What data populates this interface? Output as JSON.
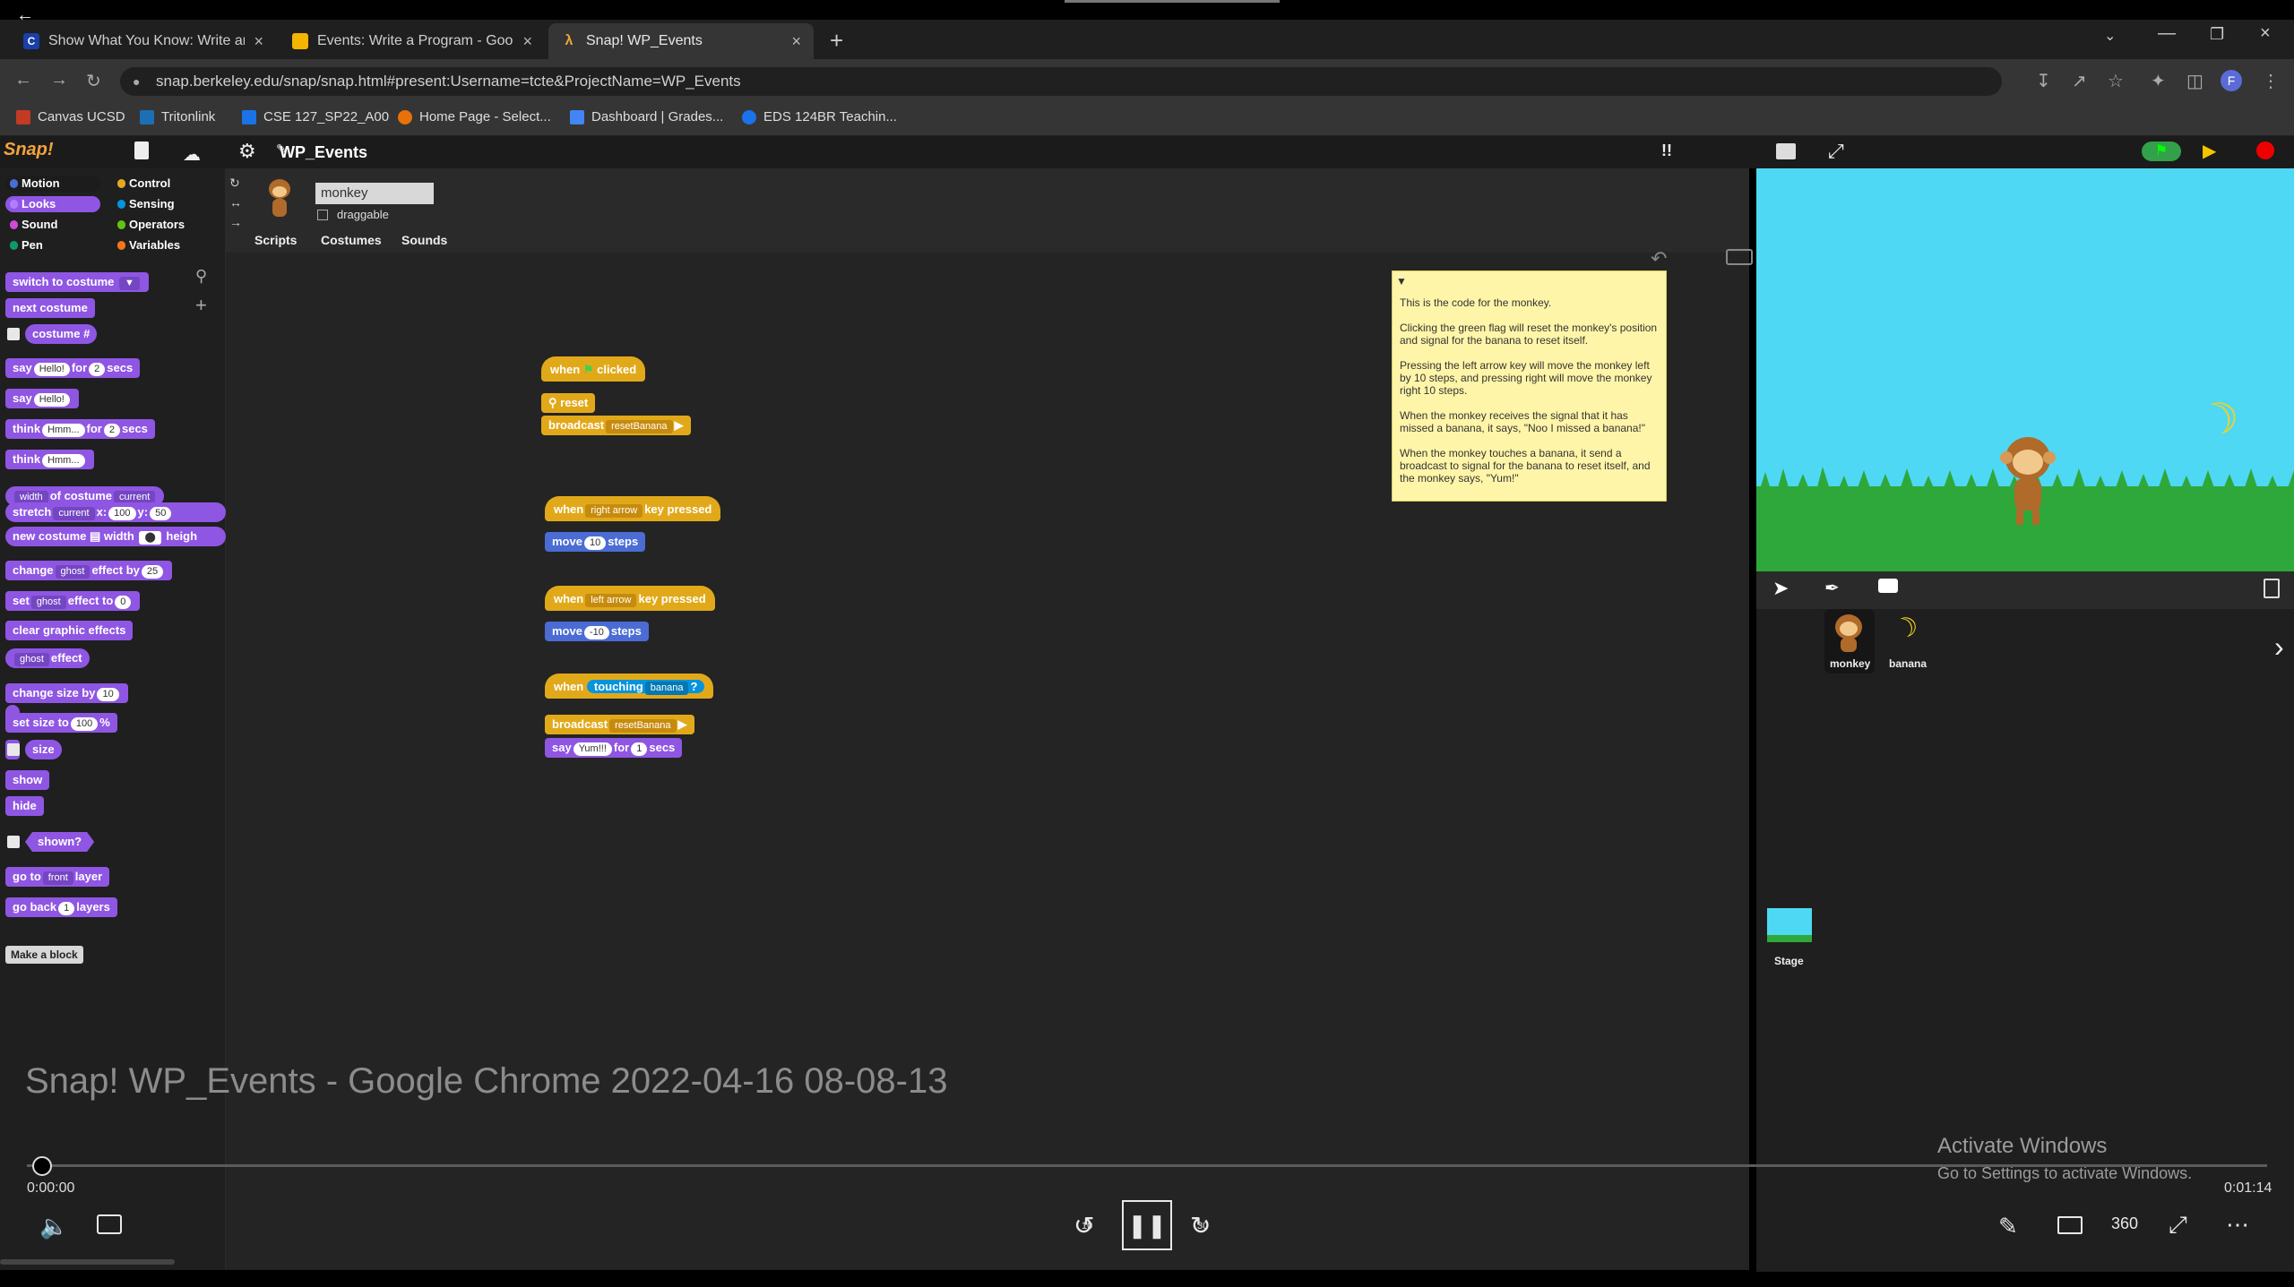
{
  "browser": {
    "tabs": [
      {
        "label": "Show What You Know: Write and",
        "icon": "canvas-icon",
        "active": false
      },
      {
        "label": "Events: Write a Program - Googl",
        "icon": "slides-icon",
        "active": false
      },
      {
        "label": "Snap! WP_Events",
        "icon": "snap-icon",
        "active": true
      }
    ],
    "url": "snap.berkeley.edu/snap/snap.html#present:Username=tcte&ProjectName=WP_Events",
    "profile_initial": "F",
    "bookmarks": [
      {
        "label": "Canvas UCSD",
        "color": "#c23b22"
      },
      {
        "label": "Tritonlink",
        "color": "#1c6fb5"
      },
      {
        "label": "CSE 127_SP22_A00",
        "color": "#1a73e8"
      },
      {
        "label": "Home Page - Select...",
        "color": "#e8710a"
      },
      {
        "label": "Dashboard | Grades...",
        "color": "#4285f4"
      },
      {
        "label": "EDS 124BR Teachin...",
        "color": "#1a73e8"
      }
    ]
  },
  "snap": {
    "logo": "Snap!",
    "project_title": "WP_Events",
    "categories": [
      {
        "label": "Motion",
        "color": "#4a6cd4"
      },
      {
        "label": "Looks",
        "color": "#8f56e3"
      },
      {
        "label": "Sound",
        "color": "#cf4ad9"
      },
      {
        "label": "Pen",
        "color": "#0e9a6c"
      },
      {
        "label": "Control",
        "color": "#e6a822"
      },
      {
        "label": "Sensing",
        "color": "#0494dc"
      },
      {
        "label": "Operators",
        "color": "#62c213"
      },
      {
        "label": "Variables",
        "color": "#f3761d"
      }
    ],
    "palette_blocks": {
      "switch_to_costume": "switch to costume",
      "next_costume": "next costume",
      "costume_num": "costume #",
      "say_for_a": "say",
      "say_for_b": "for",
      "say_for_c": "secs",
      "say_hello_value": "Hello!",
      "say_secs_value": "2",
      "say": "say",
      "think_for_a": "think",
      "think_for_b": "for",
      "think_for_c": "secs",
      "think_value": "Hmm...",
      "think_secs_value": "2",
      "think": "think",
      "width_of_costume_a": "width",
      "width_of_costume_b": "of costume",
      "width_of_costume_c": "current",
      "stretch_a": "stretch",
      "stretch_b": "current",
      "stretch_c": "x:",
      "stretch_x_value": "100",
      "stretch_d": "y:",
      "stretch_y_value": "50",
      "new_costume_a": "new costume",
      "new_costume_b": "width",
      "new_costume_c": "heigh",
      "change_effect_a": "change",
      "change_effect_b": "ghost",
      "change_effect_c": "effect by",
      "change_effect_value": "25",
      "set_effect_a": "set",
      "set_effect_b": "ghost",
      "set_effect_c": "effect to",
      "set_effect_value": "0",
      "clear_graphic_effects": "clear graphic effects",
      "ghost_effect_a": "ghost",
      "ghost_effect_b": "effect",
      "change_size_a": "change size by",
      "change_size_value": "10",
      "set_size_a": "set size to",
      "set_size_value": "100",
      "set_size_b": "%",
      "size": "size",
      "show": "show",
      "hide": "hide",
      "shown": "shown?",
      "go_to_layer_a": "go to",
      "go_to_layer_b": "front",
      "go_to_layer_c": "layer",
      "go_back_a": "go back",
      "go_back_value": "1",
      "go_back_b": "layers",
      "make_a_block": "Make a block"
    },
    "sprite": {
      "name": "monkey",
      "draggable_label": "draggable",
      "tabs": [
        "Scripts",
        "Costumes",
        "Sounds"
      ]
    },
    "scripts": {
      "s1_hat_a": "when",
      "s1_hat_b": "clicked",
      "s1_reset": "reset",
      "s1_broadcast": "broadcast",
      "s1_broadcast_msg": "resetBanana",
      "s2_hat_a": "when",
      "s2_key": "right arrow",
      "s2_hat_b": "key pressed",
      "s2_move_a": "move",
      "s2_move_value": "10",
      "s2_move_b": "steps",
      "s3_hat_a": "when",
      "s3_key": "left arrow",
      "s3_hat_b": "key pressed",
      "s3_move_a": "move",
      "s3_move_value": "-10",
      "s3_move_b": "steps",
      "s4_hat_a": "when",
      "s4_touching": "touching",
      "s4_touching_target": "banana",
      "s4_touching_q": "?",
      "s4_broadcast": "broadcast",
      "s4_broadcast_msg": "resetBanana",
      "s4_say_a": "say",
      "s4_say_value": "Yum!!!",
      "s4_say_b": "for",
      "s4_say_secs": "1",
      "s4_say_c": "secs"
    },
    "comment": [
      "This is the code for the monkey.",
      "Clicking the green flag will reset the monkey's position and signal for the banana to reset itself.",
      "Pressing the left arrow key will move the monkey left by 10 steps, and pressing right will move the monkey right 10 steps.",
      "When the monkey receives the signal that it has missed a banana, it says, \"Noo I missed a banana!\"",
      "When the monkey touches a banana, it send a broadcast to signal for the banana to reset itself, and the monkey says, \"Yum!\""
    ],
    "corral": {
      "sprites": [
        "monkey",
        "banana"
      ],
      "stage_label": "Stage"
    }
  },
  "video": {
    "title": "Snap! WP_Events - Google Chrome 2022-04-16 08-08-13",
    "current_time": "0:00:00",
    "duration": "0:01:14",
    "skip_back": "10",
    "skip_forward": "30",
    "progress": 0.0
  },
  "watermark": {
    "line1": "Activate Windows",
    "line2": "Go to Settings to activate Windows."
  }
}
